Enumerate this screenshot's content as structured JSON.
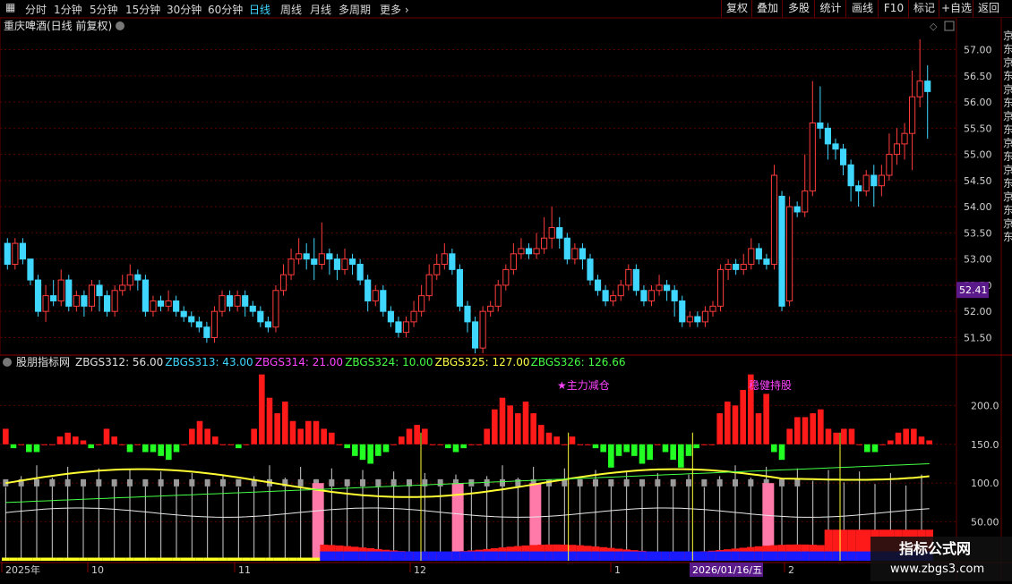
{
  "toolbar": {
    "tabs": [
      "分时",
      "1分钟",
      "5分钟",
      "15分钟",
      "30分钟",
      "60分钟",
      "日线",
      "周线",
      "月线",
      "多周期",
      "更多"
    ],
    "active_tab": "日线",
    "right_buttons": [
      "复权",
      "叠加",
      "多股",
      "统计",
      "画线",
      "F10",
      "标记",
      "+自选",
      "返回"
    ]
  },
  "price_panel": {
    "title": "重庆啤酒(日线 前复权)",
    "current_price": "52.41",
    "axis_labels": [
      "57.00",
      "56.50",
      "56.00",
      "55.50",
      "55.00",
      "54.50",
      "54.00",
      "53.50",
      "53.00",
      "52.50",
      "52.00",
      "51.50"
    ],
    "side_text": "京东京东京东京东京东京东京东京东"
  },
  "indicator_panel": {
    "name": "股朋指标网",
    "values": [
      {
        "label": "ZBGS312: 56.00",
        "color": "#e0e0e0"
      },
      {
        "label": "ZBGS313: 43.00",
        "color": "#3fd7ff"
      },
      {
        "label": "ZBGS314: 21.00",
        "color": "#ff44ff"
      },
      {
        "label": "ZBGS324: 10.00",
        "color": "#44ff44"
      },
      {
        "label": "ZBGS325: 127.00",
        "color": "#ffff44"
      },
      {
        "label": "ZBGS326: 126.66",
        "color": "#44ff44"
      }
    ],
    "annotations": [
      {
        "text": "★主力减仓",
        "color": "#ff44ff"
      },
      {
        "text": "稳健持股",
        "color": "#ff44ff"
      }
    ],
    "axis_labels": [
      "200.0",
      "150.0",
      "100.0",
      "50.00"
    ]
  },
  "time_axis": {
    "labels": [
      "2025年",
      "10",
      "11",
      "12",
      "1",
      "2"
    ],
    "cursor_date": "2026/01/16/五"
  },
  "watermark": {
    "title": "指标公式网",
    "url": "www.zbgs3.com"
  },
  "colors": {
    "up": "#ff3c3c",
    "down": "#3fd7ff",
    "grid": "#5a0000",
    "axis_text": "#d0d0d0",
    "cursor_price_bg": "#5a1a8a"
  },
  "chart_data": [
    {
      "type": "candlestick",
      "title": "重庆啤酒(日线 前复权)",
      "y_axis_ticks": [
        51.5,
        52.0,
        52.5,
        53.0,
        53.5,
        54.0,
        54.5,
        55.0,
        55.5,
        56.0,
        56.5,
        57.0
      ],
      "ylim": [
        51.2,
        57.3
      ],
      "candles": [
        [
          53.3,
          52.9,
          53.4,
          52.8
        ],
        [
          52.9,
          53.3,
          53.4,
          52.8
        ],
        [
          53.3,
          53.0,
          53.4,
          52.9
        ],
        [
          53.0,
          52.6,
          53.0,
          52.5
        ],
        [
          52.6,
          52.0,
          52.7,
          51.9
        ],
        [
          52.0,
          52.3,
          52.5,
          51.8
        ],
        [
          52.3,
          52.2,
          52.6,
          52.1
        ],
        [
          52.2,
          52.6,
          52.8,
          52.1
        ],
        [
          52.6,
          52.1,
          52.7,
          52.0
        ],
        [
          52.1,
          52.3,
          52.4,
          52.0
        ],
        [
          52.3,
          52.1,
          52.4,
          51.9
        ],
        [
          52.1,
          52.5,
          52.6,
          52.0
        ],
        [
          52.5,
          52.3,
          52.6,
          52.0
        ],
        [
          52.3,
          52.0,
          52.4,
          51.9
        ],
        [
          52.0,
          52.4,
          52.5,
          51.9
        ],
        [
          52.4,
          52.5,
          52.7,
          52.3
        ],
        [
          52.5,
          52.7,
          52.9,
          52.4
        ],
        [
          52.7,
          52.6,
          52.8,
          52.4
        ],
        [
          52.6,
          52.0,
          52.7,
          51.9
        ],
        [
          52.0,
          52.2,
          52.3,
          51.9
        ],
        [
          52.2,
          52.1,
          52.3,
          52.0
        ],
        [
          52.1,
          52.2,
          52.4,
          52.0
        ],
        [
          52.2,
          52.0,
          52.3,
          51.9
        ],
        [
          52.0,
          51.9,
          52.1,
          51.8
        ],
        [
          51.9,
          51.8,
          52.0,
          51.7
        ],
        [
          51.8,
          51.7,
          51.9,
          51.6
        ],
        [
          51.7,
          51.5,
          51.8,
          51.4
        ],
        [
          51.5,
          52.0,
          52.1,
          51.4
        ],
        [
          52.0,
          52.3,
          52.4,
          51.9
        ],
        [
          52.3,
          52.1,
          52.4,
          52.0
        ],
        [
          52.1,
          52.3,
          52.4,
          52.0
        ],
        [
          52.3,
          52.1,
          52.4,
          51.9
        ],
        [
          52.1,
          52.0,
          52.2,
          51.9
        ],
        [
          52.0,
          51.8,
          52.1,
          51.7
        ],
        [
          51.8,
          51.7,
          51.9,
          51.6
        ],
        [
          51.7,
          52.4,
          52.5,
          51.6
        ],
        [
          52.4,
          52.7,
          52.9,
          52.3
        ],
        [
          52.7,
          53.0,
          53.2,
          52.6
        ],
        [
          53.0,
          53.1,
          53.4,
          52.9
        ],
        [
          53.1,
          53.0,
          53.3,
          52.8
        ],
        [
          53.0,
          52.9,
          53.4,
          52.6
        ],
        [
          52.9,
          53.1,
          53.7,
          52.8
        ],
        [
          53.1,
          53.0,
          53.2,
          52.7
        ],
        [
          53.0,
          52.8,
          53.1,
          52.6
        ],
        [
          52.8,
          53.0,
          53.2,
          52.7
        ],
        [
          53.0,
          52.9,
          53.1,
          52.7
        ],
        [
          52.9,
          52.6,
          53.0,
          52.5
        ],
        [
          52.6,
          52.2,
          52.7,
          52.0
        ],
        [
          52.2,
          52.4,
          52.5,
          52.1
        ],
        [
          52.4,
          52.0,
          52.5,
          51.9
        ],
        [
          52.0,
          51.8,
          52.1,
          51.7
        ],
        [
          51.8,
          51.6,
          51.9,
          51.5
        ],
        [
          51.6,
          51.8,
          51.9,
          51.5
        ],
        [
          51.8,
          52.0,
          52.2,
          51.7
        ],
        [
          52.0,
          52.3,
          52.5,
          51.9
        ],
        [
          52.3,
          52.7,
          52.9,
          52.2
        ],
        [
          52.7,
          52.9,
          53.1,
          52.6
        ],
        [
          52.9,
          53.1,
          53.3,
          52.8
        ],
        [
          53.1,
          52.8,
          53.2,
          52.7
        ],
        [
          52.8,
          52.1,
          52.9,
          52.0
        ],
        [
          52.1,
          51.8,
          52.2,
          51.6
        ],
        [
          51.8,
          51.3,
          51.9,
          51.2
        ],
        [
          51.3,
          52.0,
          52.1,
          51.2
        ],
        [
          52.0,
          52.1,
          52.2,
          51.9
        ],
        [
          52.1,
          52.5,
          52.6,
          52.0
        ],
        [
          52.5,
          52.8,
          52.9,
          52.4
        ],
        [
          52.8,
          53.1,
          53.3,
          52.7
        ],
        [
          53.1,
          53.2,
          53.4,
          53.0
        ],
        [
          53.2,
          53.1,
          53.3,
          53.0
        ],
        [
          53.1,
          53.2,
          53.5,
          53.0
        ],
        [
          53.2,
          53.4,
          53.8,
          53.1
        ],
        [
          53.4,
          53.6,
          54.0,
          53.2
        ],
        [
          53.6,
          53.4,
          53.8,
          53.2
        ],
        [
          53.4,
          53.0,
          53.5,
          52.9
        ],
        [
          53.0,
          53.2,
          53.3,
          52.9
        ],
        [
          53.2,
          53.0,
          53.3,
          52.8
        ],
        [
          53.0,
          52.6,
          53.1,
          52.5
        ],
        [
          52.6,
          52.4,
          52.7,
          52.3
        ],
        [
          52.4,
          52.2,
          52.5,
          52.1
        ],
        [
          52.2,
          52.3,
          52.4,
          52.1
        ],
        [
          52.3,
          52.5,
          52.6,
          52.2
        ],
        [
          52.5,
          52.8,
          52.9,
          52.4
        ],
        [
          52.8,
          52.4,
          52.9,
          52.3
        ],
        [
          52.4,
          52.2,
          52.5,
          52.1
        ],
        [
          52.2,
          52.4,
          52.5,
          52.1
        ],
        [
          52.4,
          52.5,
          52.7,
          52.3
        ],
        [
          52.5,
          52.4,
          52.6,
          52.2
        ],
        [
          52.4,
          52.2,
          52.5,
          51.9
        ],
        [
          52.2,
          51.8,
          52.3,
          51.7
        ],
        [
          51.8,
          51.9,
          52.0,
          51.7
        ],
        [
          51.9,
          51.8,
          52.0,
          51.7
        ],
        [
          51.8,
          52.0,
          52.1,
          51.7
        ],
        [
          52.0,
          52.1,
          52.2,
          51.9
        ],
        [
          52.1,
          52.8,
          52.9,
          52.0
        ],
        [
          52.8,
          52.9,
          53.0,
          52.6
        ],
        [
          52.9,
          52.8,
          53.0,
          52.7
        ],
        [
          52.8,
          52.9,
          53.1,
          52.7
        ],
        [
          52.9,
          53.2,
          53.4,
          52.8
        ],
        [
          53.2,
          53.0,
          53.3,
          52.9
        ],
        [
          53.0,
          52.9,
          53.1,
          52.8
        ],
        [
          52.9,
          54.6,
          54.8,
          52.8
        ],
        [
          54.2,
          52.1,
          54.3,
          52.0
        ],
        [
          52.2,
          54.0,
          54.2,
          52.1
        ],
        [
          54.0,
          53.9,
          54.1,
          53.8
        ],
        [
          53.9,
          54.3,
          55.0,
          53.8
        ],
        [
          54.3,
          55.6,
          56.4,
          54.2
        ],
        [
          55.6,
          55.5,
          56.3,
          55.3
        ],
        [
          55.5,
          55.2,
          55.6,
          54.9
        ],
        [
          55.2,
          55.1,
          55.3,
          54.9
        ],
        [
          55.1,
          54.8,
          55.2,
          54.6
        ],
        [
          54.8,
          54.4,
          54.9,
          54.1
        ],
        [
          54.4,
          54.3,
          54.5,
          54.0
        ],
        [
          54.3,
          54.6,
          54.7,
          54.2
        ],
        [
          54.6,
          54.4,
          54.8,
          54.0
        ],
        [
          54.4,
          54.6,
          54.8,
          54.2
        ],
        [
          54.6,
          55.0,
          55.4,
          54.5
        ],
        [
          55.0,
          55.2,
          55.5,
          54.8
        ],
        [
          55.2,
          55.4,
          55.6,
          54.9
        ],
        [
          55.4,
          56.1,
          56.6,
          54.7
        ],
        [
          56.1,
          56.4,
          57.2,
          55.9
        ],
        [
          56.4,
          56.2,
          56.7,
          55.3
        ]
      ]
    },
    {
      "type": "bar",
      "title": "股朋指标网",
      "y_axis_ticks": [
        50,
        100,
        150,
        200
      ],
      "ylim": [
        0,
        250
      ],
      "baseline": 150,
      "series": [
        {
          "name": "ZBGS312",
          "values": [
            56
          ]
        },
        {
          "name": "ZBGS313",
          "values": [
            43
          ]
        },
        {
          "name": "ZBGS314",
          "values": [
            21
          ]
        },
        {
          "name": "ZBGS324",
          "values": [
            10
          ]
        },
        {
          "name": "ZBGS325",
          "values": [
            127
          ]
        },
        {
          "name": "ZBGS326",
          "values": [
            126.66
          ]
        }
      ],
      "histogram": [
        170,
        145,
        150,
        140,
        140,
        150,
        150,
        160,
        165,
        160,
        155,
        145,
        150,
        170,
        160,
        150,
        140,
        150,
        140,
        140,
        135,
        130,
        140,
        150,
        170,
        180,
        170,
        160,
        150,
        150,
        145,
        150,
        170,
        240,
        210,
        190,
        205,
        180,
        170,
        180,
        180,
        170,
        165,
        150,
        145,
        135,
        130,
        125,
        135,
        140,
        150,
        160,
        170,
        175,
        170,
        150,
        150,
        145,
        140,
        145,
        150,
        150,
        170,
        195,
        210,
        200,
        190,
        205,
        190,
        175,
        165,
        160,
        150,
        160,
        150,
        150,
        145,
        140,
        120,
        135,
        140,
        135,
        125,
        130,
        150,
        140,
        130,
        120,
        135,
        145,
        150,
        150,
        190,
        205,
        200,
        220,
        240,
        190,
        215,
        140,
        130,
        170,
        185,
        185,
        190,
        195,
        170,
        165,
        170,
        170,
        150,
        140,
        140,
        150,
        155,
        165,
        170,
        170,
        160,
        155
      ]
    }
  ]
}
